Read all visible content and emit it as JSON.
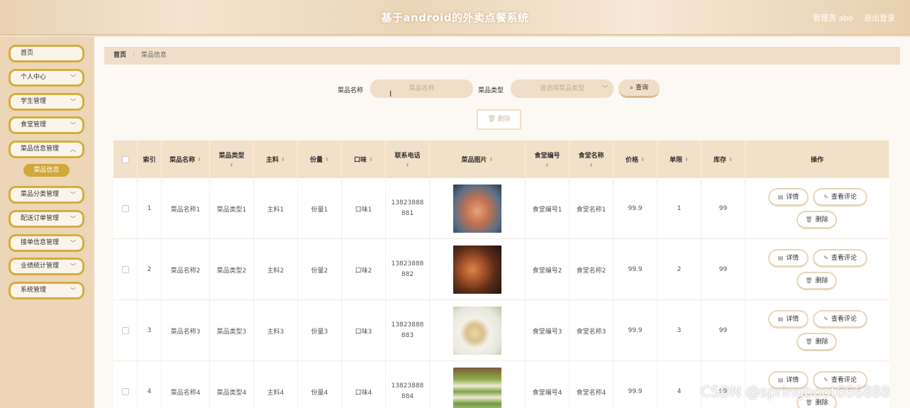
{
  "header": {
    "title": "基于android的外卖点餐系统",
    "user": "管理员 abo",
    "logout": "退出登录"
  },
  "sidebar": {
    "items": [
      {
        "label": "首页",
        "expandable": false
      },
      {
        "label": "个人中心",
        "expandable": true
      },
      {
        "label": "学生管理",
        "expandable": true
      },
      {
        "label": "食堂管理",
        "expandable": true
      },
      {
        "label": "菜品信息管理",
        "expandable": true
      },
      {
        "label": "菜品分类管理",
        "expandable": true
      },
      {
        "label": "配送订单管理",
        "expandable": true
      },
      {
        "label": "接单信息管理",
        "expandable": true
      },
      {
        "label": "业绩统计管理",
        "expandable": true
      },
      {
        "label": "系统管理",
        "expandable": true
      }
    ],
    "active_sub": "菜品信息"
  },
  "breadcrumb": {
    "home": "首页",
    "sep": "/",
    "current": "菜品信息"
  },
  "search": {
    "name_label": "菜品名称",
    "name_placeholder": "菜品名称",
    "type_label": "菜品类型",
    "type_placeholder": "请选择菜品类型",
    "query_label": "查询",
    "delete_label": "删除"
  },
  "table": {
    "headers": {
      "index": "索引",
      "name": "菜品名称",
      "type": "菜品类型",
      "main": "主料",
      "portion": "份量",
      "taste": "口味",
      "phone": "联系电话",
      "image": "菜品图片",
      "canteen_no": "食堂编号",
      "canteen_name": "食堂名称",
      "price": "价格",
      "limit": "单限",
      "stock": "库存",
      "ops": "操作"
    },
    "rows": [
      {
        "index": "1",
        "name": "菜品名称1",
        "type": "菜品类型1",
        "main": "主料1",
        "portion": "份量1",
        "taste": "口味1",
        "phone_a": "13823888",
        "phone_b": "881",
        "canteen_no": "食堂编号1",
        "canteen_name": "食堂名称1",
        "price": "99.9",
        "limit": "1",
        "stock": "99"
      },
      {
        "index": "2",
        "name": "菜品名称2",
        "type": "菜品类型2",
        "main": "主料2",
        "portion": "份量2",
        "taste": "口味2",
        "phone_a": "13823888",
        "phone_b": "882",
        "canteen_no": "食堂编号2",
        "canteen_name": "食堂名称2",
        "price": "99.9",
        "limit": "2",
        "stock": "99"
      },
      {
        "index": "3",
        "name": "菜品名称3",
        "type": "菜品类型3",
        "main": "主料3",
        "portion": "份量3",
        "taste": "口味3",
        "phone_a": "13823888",
        "phone_b": "883",
        "canteen_no": "食堂编号3",
        "canteen_name": "食堂名称3",
        "price": "99.9",
        "limit": "3",
        "stock": "99"
      },
      {
        "index": "4",
        "name": "菜品名称4",
        "type": "菜品类型4",
        "main": "主料4",
        "portion": "份量4",
        "taste": "口味4",
        "phone_a": "13823888",
        "phone_b": "884",
        "canteen_no": "食堂编号4",
        "canteen_name": "食堂名称4",
        "price": "99.9",
        "limit": "4",
        "stock": "99"
      }
    ],
    "actions": {
      "detail": "详情",
      "reviews": "查看评论",
      "delete": "删除"
    }
  },
  "watermark": "CSDN @springboot666888",
  "colors": {
    "accent": "#d4ae3f",
    "header_bg": "#f1e1c9",
    "sidebar_bg": "#ecd6b7"
  }
}
